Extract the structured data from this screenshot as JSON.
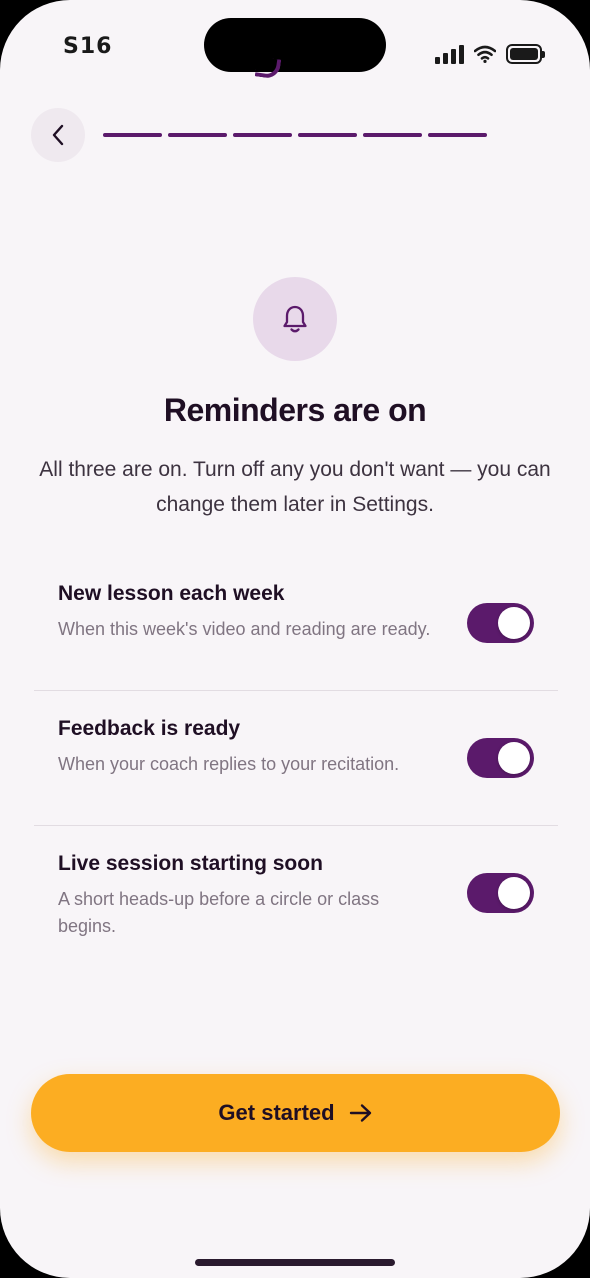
{
  "status_bar": {
    "time": "S16"
  },
  "header": {
    "back_icon": "chevron-left-icon",
    "progress_steps_total": 6,
    "progress_steps_completed": 6
  },
  "hero": {
    "icon": "bell-icon",
    "title": "Reminders are on",
    "subtitle": "All three are on. Turn off any you don't want — you can change them later in Settings."
  },
  "reminders": [
    {
      "title": "New lesson each week",
      "description": "When this week's video and reading are ready.",
      "enabled": true
    },
    {
      "title": "Feedback is ready",
      "description": "When your coach replies to your recitation.",
      "enabled": true
    },
    {
      "title": "Live session starting soon",
      "description": "A short heads-up before a circle or class begins.",
      "enabled": true
    }
  ],
  "cta": {
    "label": "Get started",
    "icon": "arrow-right-icon"
  },
  "colors": {
    "background": "#f8f5f8",
    "primary": "#5b1a6b",
    "accent": "#fcad22",
    "icon_bg": "#e8d9ea",
    "text": "#1f0f24",
    "muted_text": "#807582"
  }
}
